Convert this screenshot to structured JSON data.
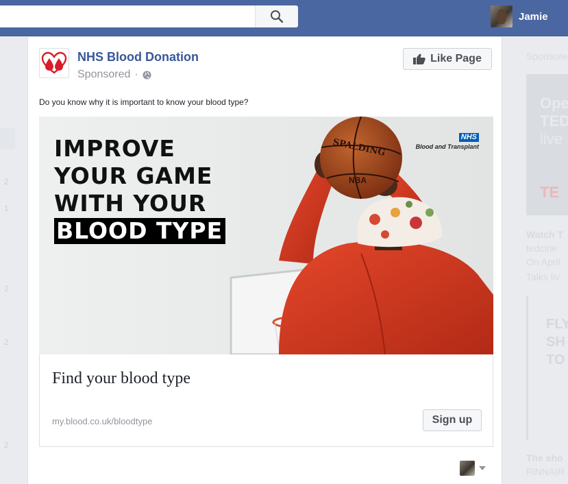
{
  "topbar": {
    "profile_name": "Jamie"
  },
  "left_numbers": [
    "2",
    "1",
    "2",
    "2",
    "2"
  ],
  "post": {
    "page_name": "NHS Blood Donation",
    "sponsored": "Sponsored",
    "separator": "·",
    "like_button": "Like Page",
    "text": "Do you know why it is important to know your blood type?",
    "ad": {
      "headline": [
        "IMPROVE",
        "YOUR GAME",
        "WITH YOUR",
        "BLOOD TYPE"
      ],
      "nhs_mark": "NHS",
      "nhs_sub": "Blood and Transplant",
      "ball_brand": "SPALDING",
      "ball_mark": "NBA"
    },
    "link": {
      "title": "Find your blood type",
      "url": "my.blood.co.uk/bloodtype",
      "cta": "Sign up"
    }
  },
  "right_column": {
    "sponsored": "Sponsored",
    "box1_lines": [
      "Ope",
      "TED",
      "live"
    ],
    "box1_red": "TE",
    "lines": [
      "Watch T",
      "tedcine",
      "On April",
      "Talks liv"
    ],
    "box2_lines": [
      "FLY",
      "SH",
      "TO"
    ],
    "bottom_lines": [
      "The sho",
      "FINNAIR"
    ]
  },
  "colors": {
    "facebook_blue": "#4b67a1",
    "link_blue": "#365899",
    "nhs_blue": "#005eb8",
    "jacket_red": "#d23a1e"
  }
}
